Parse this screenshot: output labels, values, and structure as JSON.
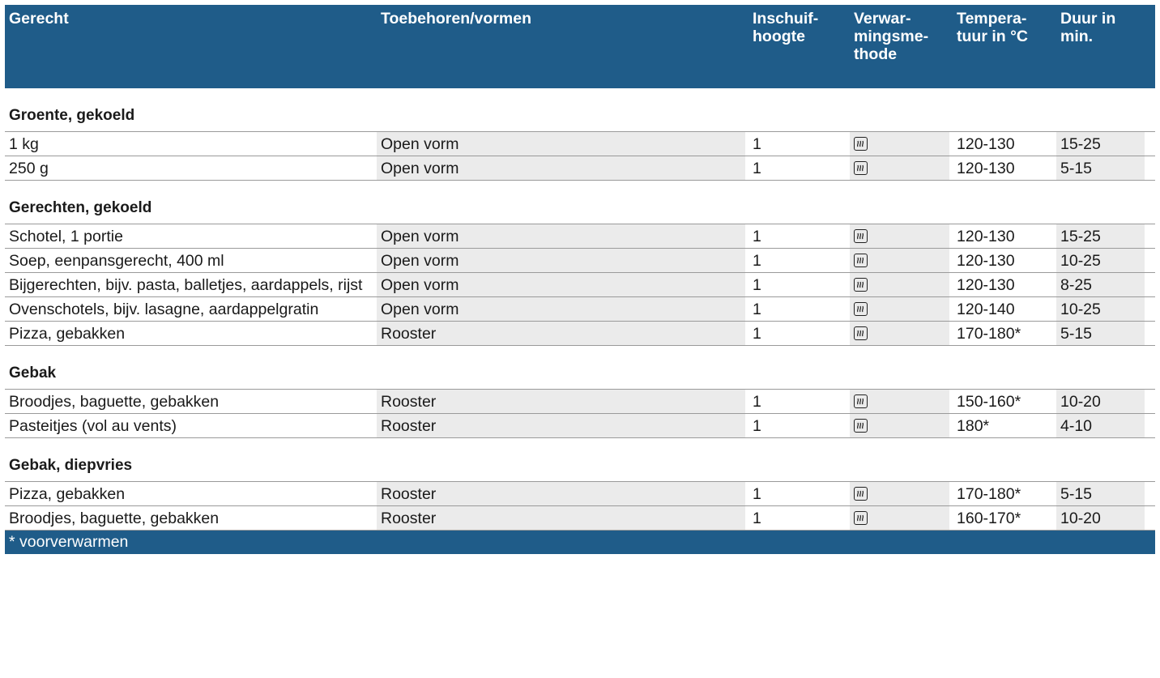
{
  "headers": [
    "Gerecht",
    "Toebehoren/vormen",
    "Inschuif-\nhoogte",
    "Verwar-\nmingsme-\nthode",
    "Tempera-\ntuur in °C",
    "Duur in\nmin."
  ],
  "heating_icon": "steam-heating-icon",
  "sections": [
    {
      "title": "Groente, gekoeld",
      "rows": [
        {
          "dish": "1 kg",
          "accessory": "Open vorm",
          "level": "1",
          "temp": "120-130",
          "time": "15-25"
        },
        {
          "dish": "250 g",
          "accessory": "Open vorm",
          "level": "1",
          "temp": "120-130",
          "time": "5-15"
        }
      ]
    },
    {
      "title": "Gerechten, gekoeld",
      "rows": [
        {
          "dish": "Schotel, 1 portie",
          "accessory": "Open vorm",
          "level": "1",
          "temp": "120-130",
          "time": "15-25"
        },
        {
          "dish": "Soep, eenpansgerecht, 400 ml",
          "accessory": "Open vorm",
          "level": "1",
          "temp": "120-130",
          "time": "10-25"
        },
        {
          "dish": "Bijgerechten, bijv. pasta, balletjes, aardappels, rijst",
          "accessory": "Open vorm",
          "level": "1",
          "temp": "120-130",
          "time": "8-25"
        },
        {
          "dish": "Ovenschotels, bijv. lasagne, aardappelgratin",
          "accessory": "Open vorm",
          "level": "1",
          "temp": "120-140",
          "time": "10-25"
        },
        {
          "dish": "Pizza, gebakken",
          "accessory": "Rooster",
          "level": "1",
          "temp": "170-180*",
          "time": "5-15"
        }
      ]
    },
    {
      "title": "Gebak",
      "rows": [
        {
          "dish": "Broodjes, baguette, gebakken",
          "accessory": "Rooster",
          "level": "1",
          "temp": "150-160*",
          "time": "10-20"
        },
        {
          "dish": "Pasteitjes (vol au vents)",
          "accessory": "Rooster",
          "level": "1",
          "temp": "180*",
          "time": "4-10"
        }
      ]
    },
    {
      "title": "Gebak, diepvries",
      "rows": [
        {
          "dish": "Pizza, gebakken",
          "accessory": "Rooster",
          "level": "1",
          "temp": "170-180*",
          "time": "5-15"
        },
        {
          "dish": "Broodjes, baguette, gebakken",
          "accessory": "Rooster",
          "level": "1",
          "temp": "160-170*",
          "time": "10-20"
        }
      ]
    }
  ],
  "footnote": "* voorverwarmen",
  "colors": {
    "header_bg": "#1f5c89",
    "shade": "#ebebeb",
    "rule": "#9a9a9a"
  }
}
